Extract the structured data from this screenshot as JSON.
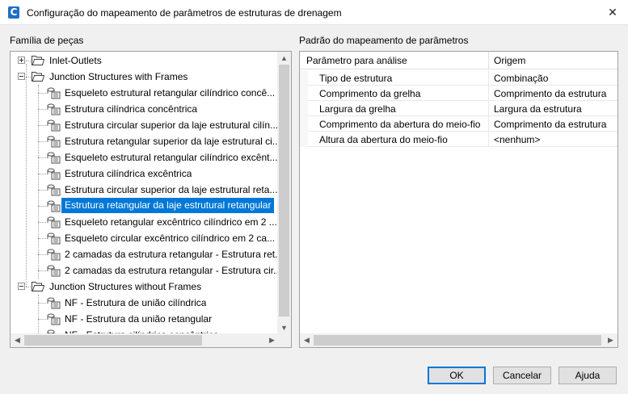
{
  "window": {
    "title": "Configuração do mapeamento de parâmetros de estruturas de drenagem",
    "app_icon_letter": "C",
    "close_glyph": "✕"
  },
  "tree_panel": {
    "label": "Família de peças",
    "groups": [
      {
        "label": "Inlet-Outlets",
        "expanded": false
      },
      {
        "label": "Junction Structures with Frames",
        "expanded": true
      },
      {
        "label": "Junction Structures without Frames",
        "expanded": true
      }
    ],
    "frames_items": [
      "Esqueleto estrutural retangular cilíndrico concê...",
      "Estrutura cilíndrica concêntrica",
      "Estrutura circular superior da laje estrutural cilín...",
      "Estrutura retangular superior da laje estrutural ci...",
      "Esqueleto estrutural retangular cilíndrico excênt...",
      "Estrutura cilíndrica excêntrica",
      "Estrutura circular superior da laje estrutural reta...",
      "Estrutura retangular da laje estrutural retangular",
      "Esqueleto retangular excêntrico cilíndrico em 2 ...",
      "Esqueleto circular excêntrico cilíndrico em 2 ca...",
      "2 camadas da estrutura retangular - Estrutura ret...",
      "2 camadas da estrutura retangular - Estrutura cir..."
    ],
    "selected_index": 7,
    "noframes_items": [
      "NF - Estrutura de união cilíndrica",
      "NF - Estrutura da união retangular",
      "NF - Estrutura cilíndrica concêntrica"
    ]
  },
  "grid_panel": {
    "label": "Padrão do mapeamento de parâmetros",
    "columns": [
      "Parâmetro para análise",
      "Origem"
    ],
    "rows": [
      {
        "param": "Tipo de estrutura",
        "origin": "Combinação"
      },
      {
        "param": "Comprimento da grelha",
        "origin": "Comprimento da estrutura"
      },
      {
        "param": "Largura da grelha",
        "origin": "Largura da estrutura"
      },
      {
        "param": "Comprimento da abertura do meio-fio",
        "origin": "Comprimento da estrutura"
      },
      {
        "param": "Altura da abertura do meio-fio",
        "origin": "<nenhum>"
      }
    ]
  },
  "buttons": {
    "ok": "OK",
    "cancel": "Cancelar",
    "help": "Ajuda"
  },
  "colors": {
    "selection": "#0078d7",
    "default_button_border": "#0078d7"
  }
}
